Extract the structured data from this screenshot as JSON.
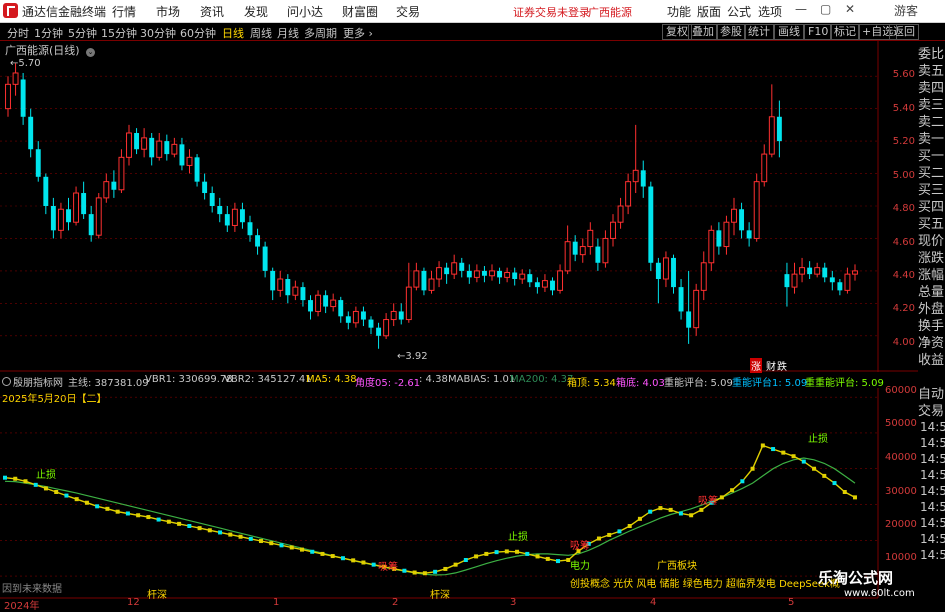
{
  "app": {
    "name": "通达信金融终端"
  },
  "menu": [
    "行情",
    "市场",
    "资讯",
    "发现",
    "问小达",
    "财富圈",
    "交易"
  ],
  "status": {
    "login": "证券交易未登录",
    "stock": "广西能源"
  },
  "right_menu": [
    "功能",
    "版面",
    "公式",
    "选项"
  ],
  "window": {
    "user": "游客"
  },
  "periods": [
    "分时",
    "1分钟",
    "5分钟",
    "15分钟",
    "30分钟",
    "60分钟",
    "日线",
    "周线",
    "月线",
    "多周期",
    "更多"
  ],
  "active_period": "日线",
  "toolbar_right": [
    "复权",
    "叠加",
    "参股",
    "统计",
    "画线",
    "F10",
    "标记",
    "+自选",
    "返回"
  ],
  "chart": {
    "title": "广西能源(日线)",
    "high_label": "5.70",
    "low_label": "3.92",
    "price_ticks": [
      "5.60",
      "5.40",
      "5.20",
      "5.00",
      "4.80",
      "4.60",
      "4.40",
      "4.20",
      "4.00"
    ],
    "markers": [
      "涨",
      "财",
      "跌"
    ]
  },
  "side_tabs": [
    "委比",
    "卖五",
    "卖四",
    "卖三",
    "卖二",
    "卖一",
    "买一",
    "买二",
    "买三",
    "买四",
    "买五",
    "现价",
    "涨跌",
    "涨幅",
    "总量",
    "外盘",
    "换手",
    "净资",
    "收益"
  ],
  "side_tabs_lower": [
    "自动",
    "交易"
  ],
  "indicator": {
    "name": "殷朋指标网",
    "items": [
      {
        "label": "主线: 387381.09",
        "color": "#c8c8c8"
      },
      {
        "label": "VBR1: 330699.78",
        "color": "#c8c8c8"
      },
      {
        "label": "VBR2: 345127.41",
        "color": "#c8c8c8"
      },
      {
        "label": "MA5: 4.38",
        "color": "#ffd700"
      },
      {
        "label": "角度05: -2.61",
        "color": "#ff55ff"
      },
      {
        "label": ": 4.38",
        "color": "#c8c8c8"
      },
      {
        "label": "MABIAS: 1.01",
        "color": "#c8c8c8"
      },
      {
        "label": "MA200: 4.37",
        "color": "#2e8b57"
      },
      {
        "label": "箱顶: 5.34",
        "color": "#ffd700"
      },
      {
        "label": "箱底: 4.03",
        "color": "#ff55ff"
      },
      {
        "label": "重能评台: 5.09",
        "color": "#c8c8c8"
      },
      {
        "label": "重能评台1: 5.09",
        "color": "#00bfff"
      },
      {
        "label": "重重能评台: 5.09",
        "color": "#7cfc00"
      }
    ],
    "date": "2025年5月20日【二】",
    "y_ticks": [
      "60000",
      "50000",
      "40000",
      "30000",
      "20000",
      "10000"
    ],
    "time_ticks": [
      "14:50",
      "14:50",
      "14:50",
      "14:50",
      "14:50",
      "14:50",
      "14:50",
      "14:50",
      "14:50"
    ],
    "annotations": [
      {
        "text": "止损",
        "color": "#7cfc00"
      },
      {
        "text": "止损",
        "color": "#7cfc00"
      },
      {
        "text": "止损",
        "color": "#7cfc00"
      },
      {
        "text": "电力",
        "color": "#7cfc00"
      },
      {
        "text": "广西板块",
        "color": "#ffd700"
      },
      {
        "text": "创投概念 光伏 风电 储能 绿色电力 超临界发电 DeepSeek概",
        "color": "#ffd700"
      },
      {
        "text": "因到未来数据",
        "color": "#888"
      },
      {
        "text": "杆深",
        "color": "#ffd700"
      },
      {
        "text": "杆深",
        "color": "#ffd700"
      },
      {
        "text": "吸筹",
        "color": "#ff3030"
      },
      {
        "text": "吸筹",
        "color": "#ff3030"
      },
      {
        "text": "吸筹",
        "color": "#ff3030"
      }
    ],
    "x_ticks": [
      "2024年",
      "12",
      "1",
      "2",
      "3",
      "4",
      "5"
    ]
  },
  "watermark": {
    "main": "乐淘公式网",
    "sub": "www.60lt.com"
  },
  "colors": {
    "up": "#ff3030",
    "down": "#00e5ee",
    "grid": "#7a0000",
    "accent": "#ffd700"
  },
  "chart_data": {
    "type": "candlestick",
    "title": "广西能源(日线)",
    "ylim": [
      3.9,
      5.7
    ],
    "y_ticks": [
      4.0,
      4.2,
      4.4,
      4.6,
      4.8,
      5.0,
      5.2,
      5.4,
      5.6
    ],
    "candles": [
      [
        5.4,
        5.55,
        5.35,
        5.6
      ],
      [
        5.55,
        5.62,
        5.48,
        5.68
      ],
      [
        5.58,
        5.35,
        5.3,
        5.62
      ],
      [
        5.35,
        5.15,
        5.1,
        5.4
      ],
      [
        5.15,
        4.98,
        4.95,
        5.2
      ],
      [
        4.98,
        4.8,
        4.75,
        5.0
      ],
      [
        4.8,
        4.65,
        4.6,
        4.85
      ],
      [
        4.65,
        4.78,
        4.6,
        4.82
      ],
      [
        4.78,
        4.7,
        4.65,
        4.85
      ],
      [
        4.7,
        4.88,
        4.68,
        4.92
      ],
      [
        4.88,
        4.75,
        4.72,
        4.95
      ],
      [
        4.75,
        4.62,
        4.58,
        4.8
      ],
      [
        4.62,
        4.85,
        4.6,
        4.88
      ],
      [
        4.85,
        4.95,
        4.82,
        5.0
      ],
      [
        4.95,
        4.9,
        4.85,
        5.02
      ],
      [
        4.9,
        5.1,
        4.88,
        5.15
      ],
      [
        5.1,
        5.25,
        5.05,
        5.3
      ],
      [
        5.25,
        5.15,
        5.12,
        5.28
      ],
      [
        5.15,
        5.22,
        5.1,
        5.28
      ],
      [
        5.22,
        5.1,
        5.05,
        5.25
      ],
      [
        5.1,
        5.2,
        5.08,
        5.25
      ],
      [
        5.2,
        5.12,
        5.08,
        5.24
      ],
      [
        5.12,
        5.18,
        5.1,
        5.22
      ],
      [
        5.18,
        5.05,
        5.02,
        5.22
      ],
      [
        5.05,
        5.1,
        5.0,
        5.15
      ],
      [
        5.1,
        4.95,
        4.92,
        5.12
      ],
      [
        4.95,
        4.88,
        4.84,
        5.0
      ],
      [
        4.88,
        4.8,
        4.76,
        4.92
      ],
      [
        4.8,
        4.75,
        4.7,
        4.85
      ],
      [
        4.75,
        4.68,
        4.64,
        4.8
      ],
      [
        4.68,
        4.78,
        4.64,
        4.82
      ],
      [
        4.78,
        4.7,
        4.66,
        4.82
      ],
      [
        4.7,
        4.62,
        4.58,
        4.74
      ],
      [
        4.62,
        4.55,
        4.5,
        4.66
      ],
      [
        4.55,
        4.4,
        4.36,
        4.58
      ],
      [
        4.4,
        4.28,
        4.22,
        4.42
      ],
      [
        4.28,
        4.35,
        4.24,
        4.4
      ],
      [
        4.35,
        4.25,
        4.2,
        4.38
      ],
      [
        4.25,
        4.3,
        4.22,
        4.34
      ],
      [
        4.3,
        4.22,
        4.18,
        4.33
      ],
      [
        4.22,
        4.15,
        4.1,
        4.25
      ],
      [
        4.15,
        4.25,
        4.12,
        4.28
      ],
      [
        4.25,
        4.18,
        4.14,
        4.28
      ],
      [
        4.18,
        4.22,
        4.15,
        4.26
      ],
      [
        4.22,
        4.12,
        4.08,
        4.24
      ],
      [
        4.12,
        4.08,
        4.04,
        4.15
      ],
      [
        4.08,
        4.15,
        4.05,
        4.18
      ],
      [
        4.15,
        4.1,
        4.06,
        4.18
      ],
      [
        4.1,
        4.05,
        4.01,
        4.12
      ],
      [
        4.05,
        4.0,
        3.92,
        4.08
      ],
      [
        4.0,
        4.1,
        3.98,
        4.14
      ],
      [
        4.1,
        4.15,
        4.06,
        4.2
      ],
      [
        4.15,
        4.1,
        4.07,
        4.2
      ],
      [
        4.1,
        4.3,
        4.08,
        4.45
      ],
      [
        4.3,
        4.4,
        4.28,
        4.45
      ],
      [
        4.4,
        4.28,
        4.25,
        4.42
      ],
      [
        4.28,
        4.35,
        4.26,
        4.4
      ],
      [
        4.35,
        4.42,
        4.3,
        4.46
      ],
      [
        4.42,
        4.38,
        4.32,
        4.45
      ],
      [
        4.38,
        4.45,
        4.35,
        4.5
      ],
      [
        4.45,
        4.4,
        4.36,
        4.48
      ],
      [
        4.4,
        4.36,
        4.32,
        4.44
      ],
      [
        4.36,
        4.4,
        4.33,
        4.44
      ],
      [
        4.4,
        4.37,
        4.33,
        4.43
      ],
      [
        4.37,
        4.4,
        4.34,
        4.44
      ],
      [
        4.4,
        4.36,
        4.32,
        4.42
      ],
      [
        4.36,
        4.39,
        4.33,
        4.42
      ],
      [
        4.39,
        4.35,
        4.31,
        4.42
      ],
      [
        4.35,
        4.38,
        4.32,
        4.41
      ],
      [
        4.38,
        4.33,
        4.3,
        4.41
      ],
      [
        4.33,
        4.3,
        4.26,
        4.36
      ],
      [
        4.3,
        4.34,
        4.27,
        4.38
      ],
      [
        4.34,
        4.28,
        4.25,
        4.36
      ],
      [
        4.28,
        4.4,
        4.26,
        4.44
      ],
      [
        4.4,
        4.58,
        4.38,
        4.68
      ],
      [
        4.58,
        4.5,
        4.46,
        4.62
      ],
      [
        4.5,
        4.55,
        4.45,
        4.6
      ],
      [
        4.55,
        4.65,
        4.5,
        4.7
      ],
      [
        4.55,
        4.45,
        4.4,
        4.6
      ],
      [
        4.45,
        4.6,
        4.42,
        4.65
      ],
      [
        4.6,
        4.7,
        4.55,
        4.75
      ],
      [
        4.7,
        4.8,
        4.66,
        4.85
      ],
      [
        4.8,
        4.95,
        4.75,
        5.0
      ],
      [
        4.95,
        5.02,
        4.88,
        5.3
      ],
      [
        5.02,
        4.92,
        4.85,
        5.08
      ],
      [
        4.92,
        4.45,
        4.4,
        4.95
      ],
      [
        4.45,
        4.35,
        4.2,
        4.48
      ],
      [
        4.35,
        4.48,
        4.3,
        4.52
      ],
      [
        4.48,
        4.3,
        4.26,
        4.5
      ],
      [
        4.3,
        4.15,
        4.1,
        4.35
      ],
      [
        4.15,
        4.05,
        3.95,
        4.4
      ],
      [
        4.05,
        4.28,
        4.0,
        4.32
      ],
      [
        4.28,
        4.45,
        4.22,
        4.52
      ],
      [
        4.45,
        4.65,
        4.4,
        4.68
      ],
      [
        4.65,
        4.55,
        4.5,
        4.7
      ],
      [
        4.55,
        4.7,
        4.5,
        4.74
      ],
      [
        4.7,
        4.78,
        4.62,
        4.85
      ],
      [
        4.78,
        4.65,
        4.6,
        4.82
      ],
      [
        4.65,
        4.6,
        4.55,
        4.7
      ],
      [
        4.6,
        4.95,
        4.58,
        5.0
      ],
      [
        4.95,
        5.12,
        4.92,
        5.18
      ],
      [
        5.12,
        5.35,
        5.1,
        5.55
      ],
      [
        5.35,
        5.2,
        5.1,
        5.45
      ],
      [
        4.38,
        4.3,
        4.18,
        4.45
      ],
      [
        4.3,
        4.38,
        4.26,
        4.45
      ],
      [
        4.38,
        4.42,
        4.33,
        4.48
      ],
      [
        4.42,
        4.38,
        4.35,
        4.46
      ],
      [
        4.38,
        4.42,
        4.36,
        4.45
      ],
      [
        4.42,
        4.36,
        4.33,
        4.45
      ],
      [
        4.36,
        4.33,
        4.28,
        4.4
      ],
      [
        4.33,
        4.28,
        4.25,
        4.35
      ],
      [
        4.28,
        4.38,
        4.26,
        4.42
      ],
      [
        4.38,
        4.4,
        4.34,
        4.44
      ]
    ],
    "lower_series": {
      "ylim": [
        5000,
        62000
      ],
      "yellow": [
        37500,
        37200,
        36500,
        35500,
        34500,
        33500,
        32500,
        31500,
        30500,
        29500,
        28800,
        28000,
        27500,
        27000,
        26500,
        25800,
        25200,
        24600,
        24000,
        23400,
        22800,
        22200,
        21600,
        21000,
        20400,
        19800,
        19200,
        18600,
        18000,
        17400,
        16800,
        16200,
        15600,
        15000,
        14400,
        13800,
        13200,
        12600,
        12000,
        11500,
        11000,
        10800,
        11200,
        12000,
        13200,
        14500,
        15500,
        16200,
        16700,
        16900,
        16800,
        16200,
        15500,
        14800,
        14200,
        14500,
        17000,
        19000,
        20500,
        21500,
        22500,
        24000,
        26000,
        28000,
        29000,
        28500,
        27500,
        27000,
        28500,
        30500,
        32000,
        34000,
        36500,
        40000,
        46500,
        45500,
        44500,
        43500,
        42000,
        40000,
        38000,
        36000,
        33500,
        32000
      ],
      "green": [
        36500,
        36400,
        36000,
        35500,
        35000,
        34400,
        33800,
        33200,
        32500,
        31800,
        31100,
        30400,
        29700,
        29000,
        28300,
        27600,
        26900,
        26200,
        25500,
        24800,
        24100,
        23400,
        22700,
        22000,
        21300,
        20600,
        19900,
        19200,
        18500,
        17800,
        17100,
        16400,
        15700,
        15000,
        14300,
        13700,
        13100,
        12500,
        11900,
        11400,
        10900,
        10500,
        10300,
        10400,
        10900,
        11700,
        12600,
        13500,
        14300,
        15000,
        15600,
        16000,
        16200,
        16200,
        16000,
        15800,
        16200,
        17200,
        18500,
        20000,
        21300,
        22600,
        23800,
        25000,
        26200,
        27200,
        28000,
        28800,
        29800,
        30900,
        32000,
        33200,
        34500,
        36000,
        38000,
        40000,
        41500,
        42500,
        43000,
        42500,
        41500,
        40000,
        38000,
        36000
      ]
    }
  }
}
